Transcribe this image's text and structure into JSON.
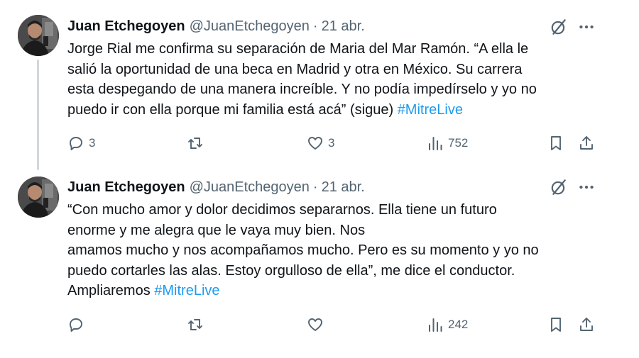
{
  "tweets": [
    {
      "author_name": "Juan Etchegoyen",
      "handle": "@JuanEtchegoyen",
      "separator": "·",
      "date": "21 abr.",
      "text_lines": [
        "Jorge Rial me confirma su separación de Maria del Mar Ramón. “A ella le",
        "salió la oportunidad de una beca en Madrid y otra en México. Su carrera",
        "esta despegando de una manera increíble. Y no podía impedírselo y yo no",
        "puedo ir con ella porque mi familia está acá” (sigue) "
      ],
      "hashtag": "#MitreLive",
      "replies": "3",
      "retweets": "",
      "likes": "3",
      "views": "752"
    },
    {
      "author_name": "Juan Etchegoyen",
      "handle": "@JuanEtchegoyen",
      "separator": "·",
      "date": "21 abr.",
      "text_lines": [
        "“Con mucho amor y dolor decidimos separarnos. Ella tiene un futuro",
        "enorme y me alegra que le vaya muy bien. Nos",
        "amamos mucho y nos acompañamos mucho. Pero es su momento y yo no",
        "puedo cortarles las alas. Estoy orgulloso de ella”, me dice el conductor.",
        "Ampliaremos "
      ],
      "hashtag": "#MitreLive",
      "replies": "",
      "retweets": "",
      "likes": "",
      "views": "242"
    }
  ],
  "colors": {
    "text": "#0f1419",
    "secondary": "#536471",
    "hashtag": "#1d9bf0",
    "thread_line": "#cfd9de"
  },
  "icons": [
    "reply-icon",
    "retweet-icon",
    "like-icon",
    "views-icon",
    "bookmark-icon",
    "share-icon",
    "grok-icon",
    "more-icon"
  ]
}
